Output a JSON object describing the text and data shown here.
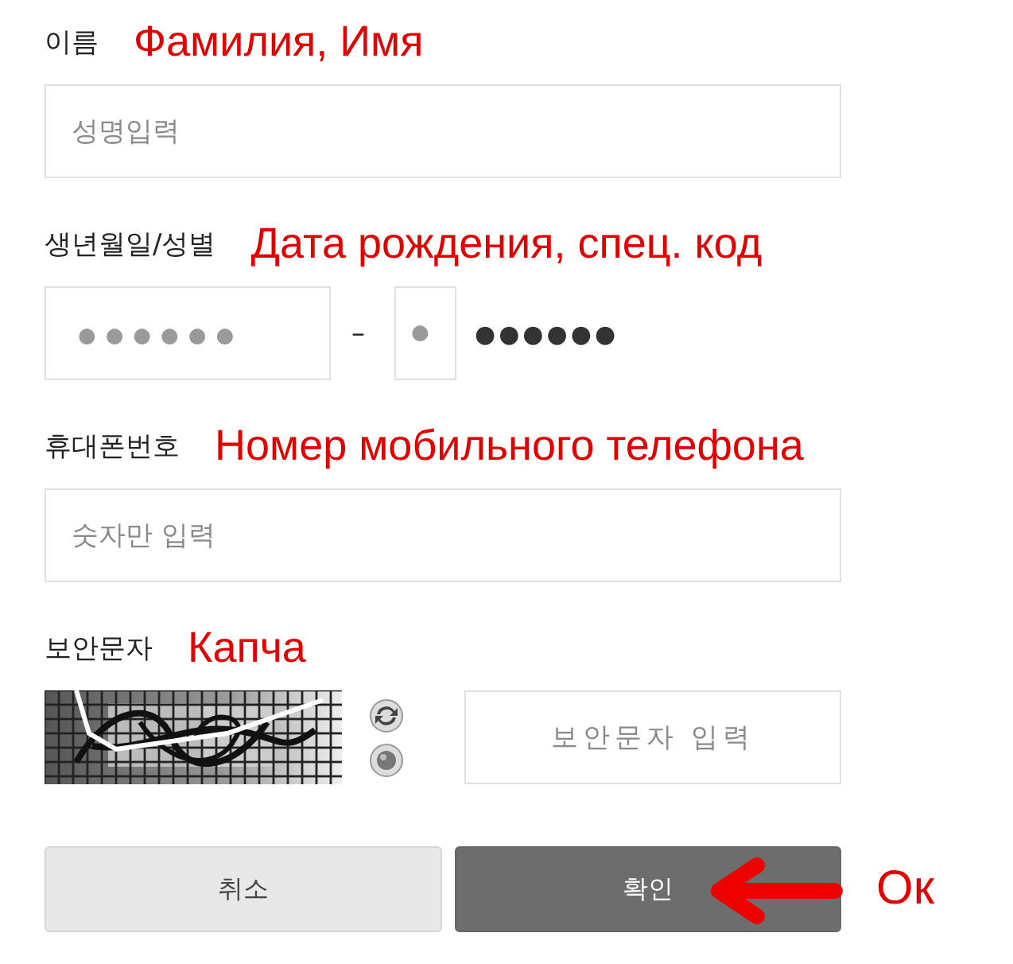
{
  "fields": [
    {
      "kind": "text",
      "label": "이름",
      "annotation": "Фамилия, Имя",
      "placeholder": "성명입력"
    },
    {
      "kind": "birth",
      "label": "생년월일/성별",
      "annotation": "Дата рождения, спец. код",
      "placeholder": "●●●●●●",
      "separator": "–",
      "code_placeholder": "●",
      "mask": "●●●●●●"
    },
    {
      "kind": "text",
      "label": "휴대폰번호",
      "annotation": "Номер мобильного телефона",
      "placeholder": "숫자만 입력"
    },
    {
      "kind": "captcha",
      "label": "보안문자",
      "annotation": "Капча",
      "placeholder": "보안문자 입력"
    }
  ],
  "buttons": [
    {
      "label": "취소",
      "kind": "secondary"
    },
    {
      "label": "확인",
      "kind": "primary"
    }
  ],
  "callout": {
    "text": "Ок"
  }
}
